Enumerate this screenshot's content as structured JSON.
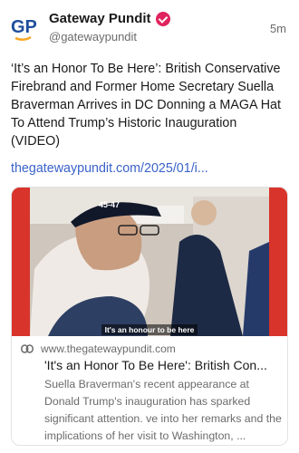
{
  "account": {
    "logo_text": "GP",
    "name": "Gateway Pundit",
    "handle": "@gatewaypundit",
    "timestamp": "5m",
    "verified_icon": "verified-badge-icon"
  },
  "post": {
    "text": "‘It’s an Honor To Be Here’: British Conservative Firebrand and Former Home Secretary Suella Braverman Arrives in DC Donning a MAGA Hat To Attend Trump’s Historic Inauguration (VIDEO)",
    "link": "thegatewaypundit.com/2025/01/i..."
  },
  "link_card": {
    "image_caption": "It's an honour to be here",
    "hat_text": "45-47",
    "domain": "www.thegatewaypundit.com",
    "title": "'It's an Honor To Be Here': British Con...",
    "description": "Suella Braverman's recent appearance at Donald Trump's inauguration has sparked significant attention. ve into her remarks and the implications of her visit to Washington, ..."
  },
  "colors": {
    "link": "#3a62c9",
    "verified": "#e0245e",
    "logo_blue": "#1f4e9c",
    "logo_orange": "#f5a623",
    "thumbnail_border": "#d8342b"
  }
}
